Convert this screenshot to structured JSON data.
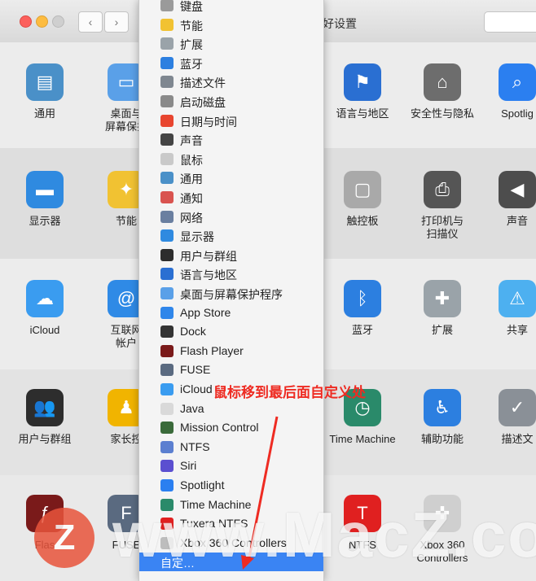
{
  "window": {
    "title": "好设置",
    "back_label": "‹",
    "forward_label": "›"
  },
  "prefs": [
    {
      "label": "通用",
      "icon": "general-icon",
      "color": "#4a90c8",
      "glyph": "▤"
    },
    {
      "label": "桌面与\n屏幕保护",
      "icon": "desktop-icon",
      "color": "#5aa0e8",
      "glyph": "▭"
    },
    {
      "label": "语言与地区",
      "icon": "flag-icon",
      "color": "#2a6fd2",
      "glyph": "⚑"
    },
    {
      "label": "安全性与隐私",
      "icon": "house-lock-icon",
      "color": "#6d6d6d",
      "glyph": "⌂"
    },
    {
      "label": "Spotlig",
      "icon": "spotlight-icon",
      "color": "#2b7ff0",
      "glyph": "⌕"
    },
    {
      "label": "显示器",
      "icon": "display-icon",
      "color": "#2f8ae0",
      "glyph": "▬"
    },
    {
      "label": "节能",
      "icon": "bulb-icon",
      "color": "#f1c232",
      "glyph": "✦"
    },
    {
      "label": "触控板",
      "icon": "trackpad-icon",
      "color": "#a9a9a9",
      "glyph": "▢"
    },
    {
      "label": "打印机与\n扫描仪",
      "icon": "printer-icon",
      "color": "#555555",
      "glyph": "⎙"
    },
    {
      "label": "声音",
      "icon": "speaker-icon",
      "color": "#4d4d4d",
      "glyph": "◀"
    },
    {
      "label": "iCloud",
      "icon": "icloud-icon",
      "color": "#3a9cf0",
      "glyph": "☁"
    },
    {
      "label": "互联网\n帐户",
      "icon": "at-icon",
      "color": "#2f8ae6",
      "glyph": "@"
    },
    {
      "label": "蓝牙",
      "icon": "bluetooth-icon",
      "color": "#2c7fe0",
      "glyph": "ᛒ"
    },
    {
      "label": "扩展",
      "icon": "puzzle-icon",
      "color": "#9aa3a9",
      "glyph": "✚"
    },
    {
      "label": "共享",
      "icon": "folder-icon",
      "color": "#4db0f0",
      "glyph": "⚠"
    },
    {
      "label": "用户与群组",
      "icon": "users-icon",
      "color": "#2d2d2d",
      "glyph": "👥"
    },
    {
      "label": "家长控",
      "icon": "parental-icon",
      "color": "#f1b400",
      "glyph": "♟"
    },
    {
      "label": "Time Machine",
      "icon": "timemachine-icon",
      "color": "#2a8a6a",
      "glyph": "◷"
    },
    {
      "label": "辅助功能",
      "icon": "accessibility-icon",
      "color": "#2c7fe0",
      "glyph": "♿"
    },
    {
      "label": "描述文",
      "icon": "profiles-icon",
      "color": "#8a9097",
      "glyph": "✓"
    },
    {
      "label": "Flas",
      "icon": "flash-icon",
      "color": "#7a1a1a",
      "glyph": "ƒ"
    },
    {
      "label": "FUSE",
      "icon": "fuse-icon",
      "color": "#5a6a80",
      "glyph": "F"
    },
    {
      "label": "NTFS",
      "icon": "tuxera-icon",
      "color": "#e02020",
      "glyph": "T"
    },
    {
      "label": "Xbox 360\nControllers",
      "icon": "gamepad-icon",
      "color": "#cfcfcf",
      "glyph": "✜"
    }
  ],
  "menu": [
    {
      "label": "键盘",
      "icon": "keyboard-icon",
      "color": "#9a9a9a"
    },
    {
      "label": "节能",
      "icon": "bulb-icon",
      "color": "#f1c232"
    },
    {
      "label": "扩展",
      "icon": "puzzle-icon",
      "color": "#9aa3a9"
    },
    {
      "label": "蓝牙",
      "icon": "bluetooth-icon",
      "color": "#2c7fe0"
    },
    {
      "label": "描述文件",
      "icon": "profiles-icon",
      "color": "#7f8790"
    },
    {
      "label": "启动磁盘",
      "icon": "disk-icon",
      "color": "#8a8a8a"
    },
    {
      "label": "日期与时间",
      "icon": "calendar-icon",
      "color": "#e8452f"
    },
    {
      "label": "声音",
      "icon": "speaker-icon",
      "color": "#444444"
    },
    {
      "label": "鼠标",
      "icon": "mouse-icon",
      "color": "#c9c9c9"
    },
    {
      "label": "通用",
      "icon": "general-icon",
      "color": "#4a90c8"
    },
    {
      "label": "通知",
      "icon": "notifications-icon",
      "color": "#d9534f"
    },
    {
      "label": "网络",
      "icon": "network-icon",
      "color": "#6a7fa0"
    },
    {
      "label": "显示器",
      "icon": "display-icon",
      "color": "#2f8ae0"
    },
    {
      "label": "用户与群组",
      "icon": "users-icon",
      "color": "#2d2d2d"
    },
    {
      "label": "语言与地区",
      "icon": "flag-icon",
      "color": "#2a6fd2"
    },
    {
      "label": "桌面与屏幕保护程序",
      "icon": "desktop-icon",
      "color": "#5aa0e8"
    },
    {
      "label": "App Store",
      "icon": "appstore-icon",
      "color": "#2f86ea"
    },
    {
      "label": "Dock",
      "icon": "dock-icon",
      "color": "#333333"
    },
    {
      "label": "Flash Player",
      "icon": "flash-icon",
      "color": "#7a1a1a"
    },
    {
      "label": "FUSE",
      "icon": "fuse-icon",
      "color": "#5a6a80"
    },
    {
      "label": "iCloud",
      "icon": "icloud-icon",
      "color": "#3a9cf0"
    },
    {
      "label": "Java",
      "icon": "java-icon",
      "color": "#d9d9d9"
    },
    {
      "label": "Mission Control",
      "icon": "missioncontrol-icon",
      "color": "#3a6a3a"
    },
    {
      "label": "NTFS",
      "icon": "ntfs-icon",
      "color": "#5b7fd0"
    },
    {
      "label": "Siri",
      "icon": "siri-icon",
      "color": "#5b4fd0"
    },
    {
      "label": "Spotlight",
      "icon": "spotlight-icon",
      "color": "#2b7ff0"
    },
    {
      "label": "Time Machine",
      "icon": "timemachine-icon",
      "color": "#2a8a6a"
    },
    {
      "label": "Tuxera NTFS",
      "icon": "tuxera-icon",
      "color": "#e02020"
    },
    {
      "label": "Xbox 360 Controllers",
      "icon": "gamepad-icon",
      "color": "#bdbdbd"
    },
    {
      "label": "自定…",
      "icon": "",
      "color": ""
    }
  ],
  "annotation": "鼠标移到最后面自定义处",
  "watermark": {
    "logo": "Z",
    "text": "www.MacZ.co"
  }
}
